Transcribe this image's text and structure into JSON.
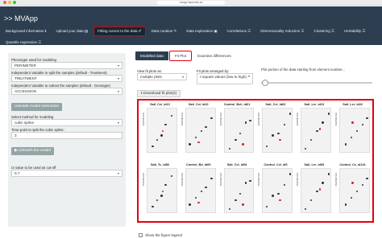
{
  "browser": {
    "url": "mvapp.kaust.edu.sa"
  },
  "app": {
    "brand": "MVApp"
  },
  "nav": {
    "row1": [
      "Background information ℹ",
      "Upload your data ▤",
      "Fitting curves to the data ✐",
      "Data curation ✎",
      "Data exploration ▣",
      "Correlations ☰",
      "Dimensionality reduction ☰",
      "Clustering ☰",
      "Heritability ☰"
    ],
    "row2": [
      "Quantile regression ☰"
    ],
    "active_index": 2
  },
  "sidebar": {
    "pheno_label": "Phenotype used for modeling",
    "pheno_value": "PERIMETER",
    "split_label": "Independent Variable to split the samples (default - Treatment)",
    "split_value": "TREATMENT",
    "subset_label": "Independent Variable to subset the samples (default - Genotype)",
    "subset_value": "ACCESSION",
    "unleash_estimation": "Unleash model estimation",
    "method_label": "Select method for modeling",
    "method_value": "cubic spline",
    "timepoint_label": "Time-point to split the cubic spline:",
    "timepoint_value": "3",
    "unleash_model": "Unleash the model",
    "r2_label": "r2 value to be used as cut-off",
    "r2_value": "0.7"
  },
  "tabs": [
    "Modelled data",
    "Fit Plot",
    "Examine differences"
  ],
  "controls": {
    "view_label": "View fit plots as:",
    "view_value": "multiple plots",
    "arrange_label": "Fit plots arranged by:",
    "arrange_value": "r-square values (low to high)",
    "portion_label": "Plot portion of the data starting from element number...",
    "download_label": "Download fit plot(s)"
  },
  "plots": [
    {
      "title": "Salt_Cvi_id13",
      "ylabel": "PERIMETER"
    },
    {
      "title": "Salt_Cvi_id32",
      "ylabel": "PERIMETER"
    },
    {
      "title": "Control_Bch_id61",
      "ylabel": "PERIMETER"
    },
    {
      "title": "Salt_Cvi_id63",
      "ylabel": "PERIMETER"
    },
    {
      "title": "Salt_Ler_id13",
      "ylabel": "PERIMETER"
    },
    {
      "title": "Salt_Ler_id22",
      "ylabel": "PERIMETER"
    },
    {
      "title": "Salt_Tc_id80",
      "ylabel": "PERIMETER"
    },
    {
      "title": "Control_Bd_id69",
      "ylabel": "PERIMETER"
    },
    {
      "title": "Salt_Cvi_id94",
      "ylabel": "PERIMETER"
    },
    {
      "title": "Control_Cvi_id5",
      "ylabel": "PERIMETER"
    },
    {
      "title": "Salt_Ler_id65",
      "ylabel": "PERIMETER"
    },
    {
      "title": "Control_Cs_id141",
      "ylabel": "PERIMETER"
    }
  ],
  "legend_checkbox": "Show the figure legend"
}
